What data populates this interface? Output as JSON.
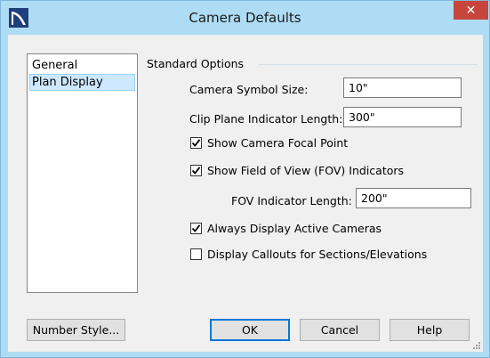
{
  "window": {
    "title": "Camera Defaults",
    "close_glyph": "✕",
    "app_icon": "chief-architect-icon"
  },
  "sidebar": {
    "items": [
      {
        "label": "General",
        "selected": false
      },
      {
        "label": "Plan Display",
        "selected": true
      }
    ],
    "number_style_label": "Number Style..."
  },
  "options": {
    "group_title": "Standard Options",
    "camera_symbol_size": {
      "label": "Camera Symbol Size:",
      "value": "10\""
    },
    "clip_plane_length": {
      "label": "Clip Plane Indicator Length:",
      "value": "300\""
    },
    "show_focal_point": {
      "label": "Show Camera Focal Point",
      "checked": true
    },
    "show_fov": {
      "label": "Show Field of View (FOV) Indicators",
      "checked": true
    },
    "fov_length": {
      "label": "FOV Indicator Length:",
      "value": "200\""
    },
    "always_display_active": {
      "label": "Always Display Active Cameras",
      "checked": true
    },
    "display_callouts": {
      "label": "Display Callouts for Sections/Elevations",
      "checked": false
    }
  },
  "buttons": {
    "ok": "OK",
    "cancel": "Cancel",
    "help": "Help"
  },
  "colors": {
    "title_bar": "#aedcf5",
    "close_button": "#c7463c",
    "selection": "#cde8ff",
    "accent": "#0078d7"
  }
}
